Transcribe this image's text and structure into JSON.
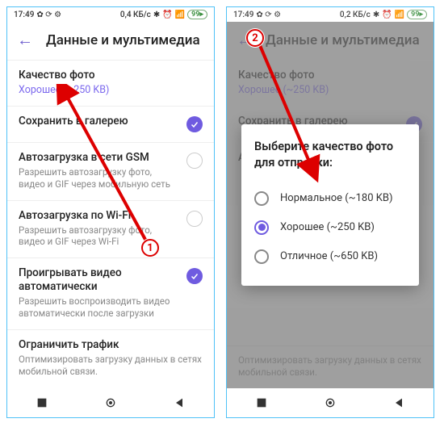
{
  "statusbar": {
    "time": "17:49",
    "speed_a": "0,4 КБ/с",
    "speed_b": "0,2 КБ/с",
    "battery": "99"
  },
  "header": {
    "title": "Данные и мультимедиа"
  },
  "quality": {
    "title": "Качество фото",
    "value": "Хорошее (~250 KB)"
  },
  "gallery": {
    "title": "Сохранить в галерею"
  },
  "gsm": {
    "title": "Автозагрузка в сети GSM",
    "sub": "Разрешить автозагрузку фото, видео и GIF через мобильную сеть"
  },
  "wifi": {
    "title": "Автозагрузка по Wi-Fi",
    "sub": "Разрешить автозагрузку фото, видео и GIF через Wi-Fi"
  },
  "autoplay": {
    "title": "Проигрывать видео автоматически",
    "sub": "Разрешить воспроизводить видео автоматически после загрузки"
  },
  "traffic": {
    "title": "Ограничить трафик",
    "sub": "Оптимизировать загрузку данных в сетях мобильной связи."
  },
  "dialog": {
    "title": "Выберите качество фото для отправки:",
    "opt1": "Нормальное (~180 KB)",
    "opt2": "Хорошее (~250 KB)",
    "opt3": "Отличное (~650 KB)"
  },
  "marker1": "1",
  "marker2": "2"
}
